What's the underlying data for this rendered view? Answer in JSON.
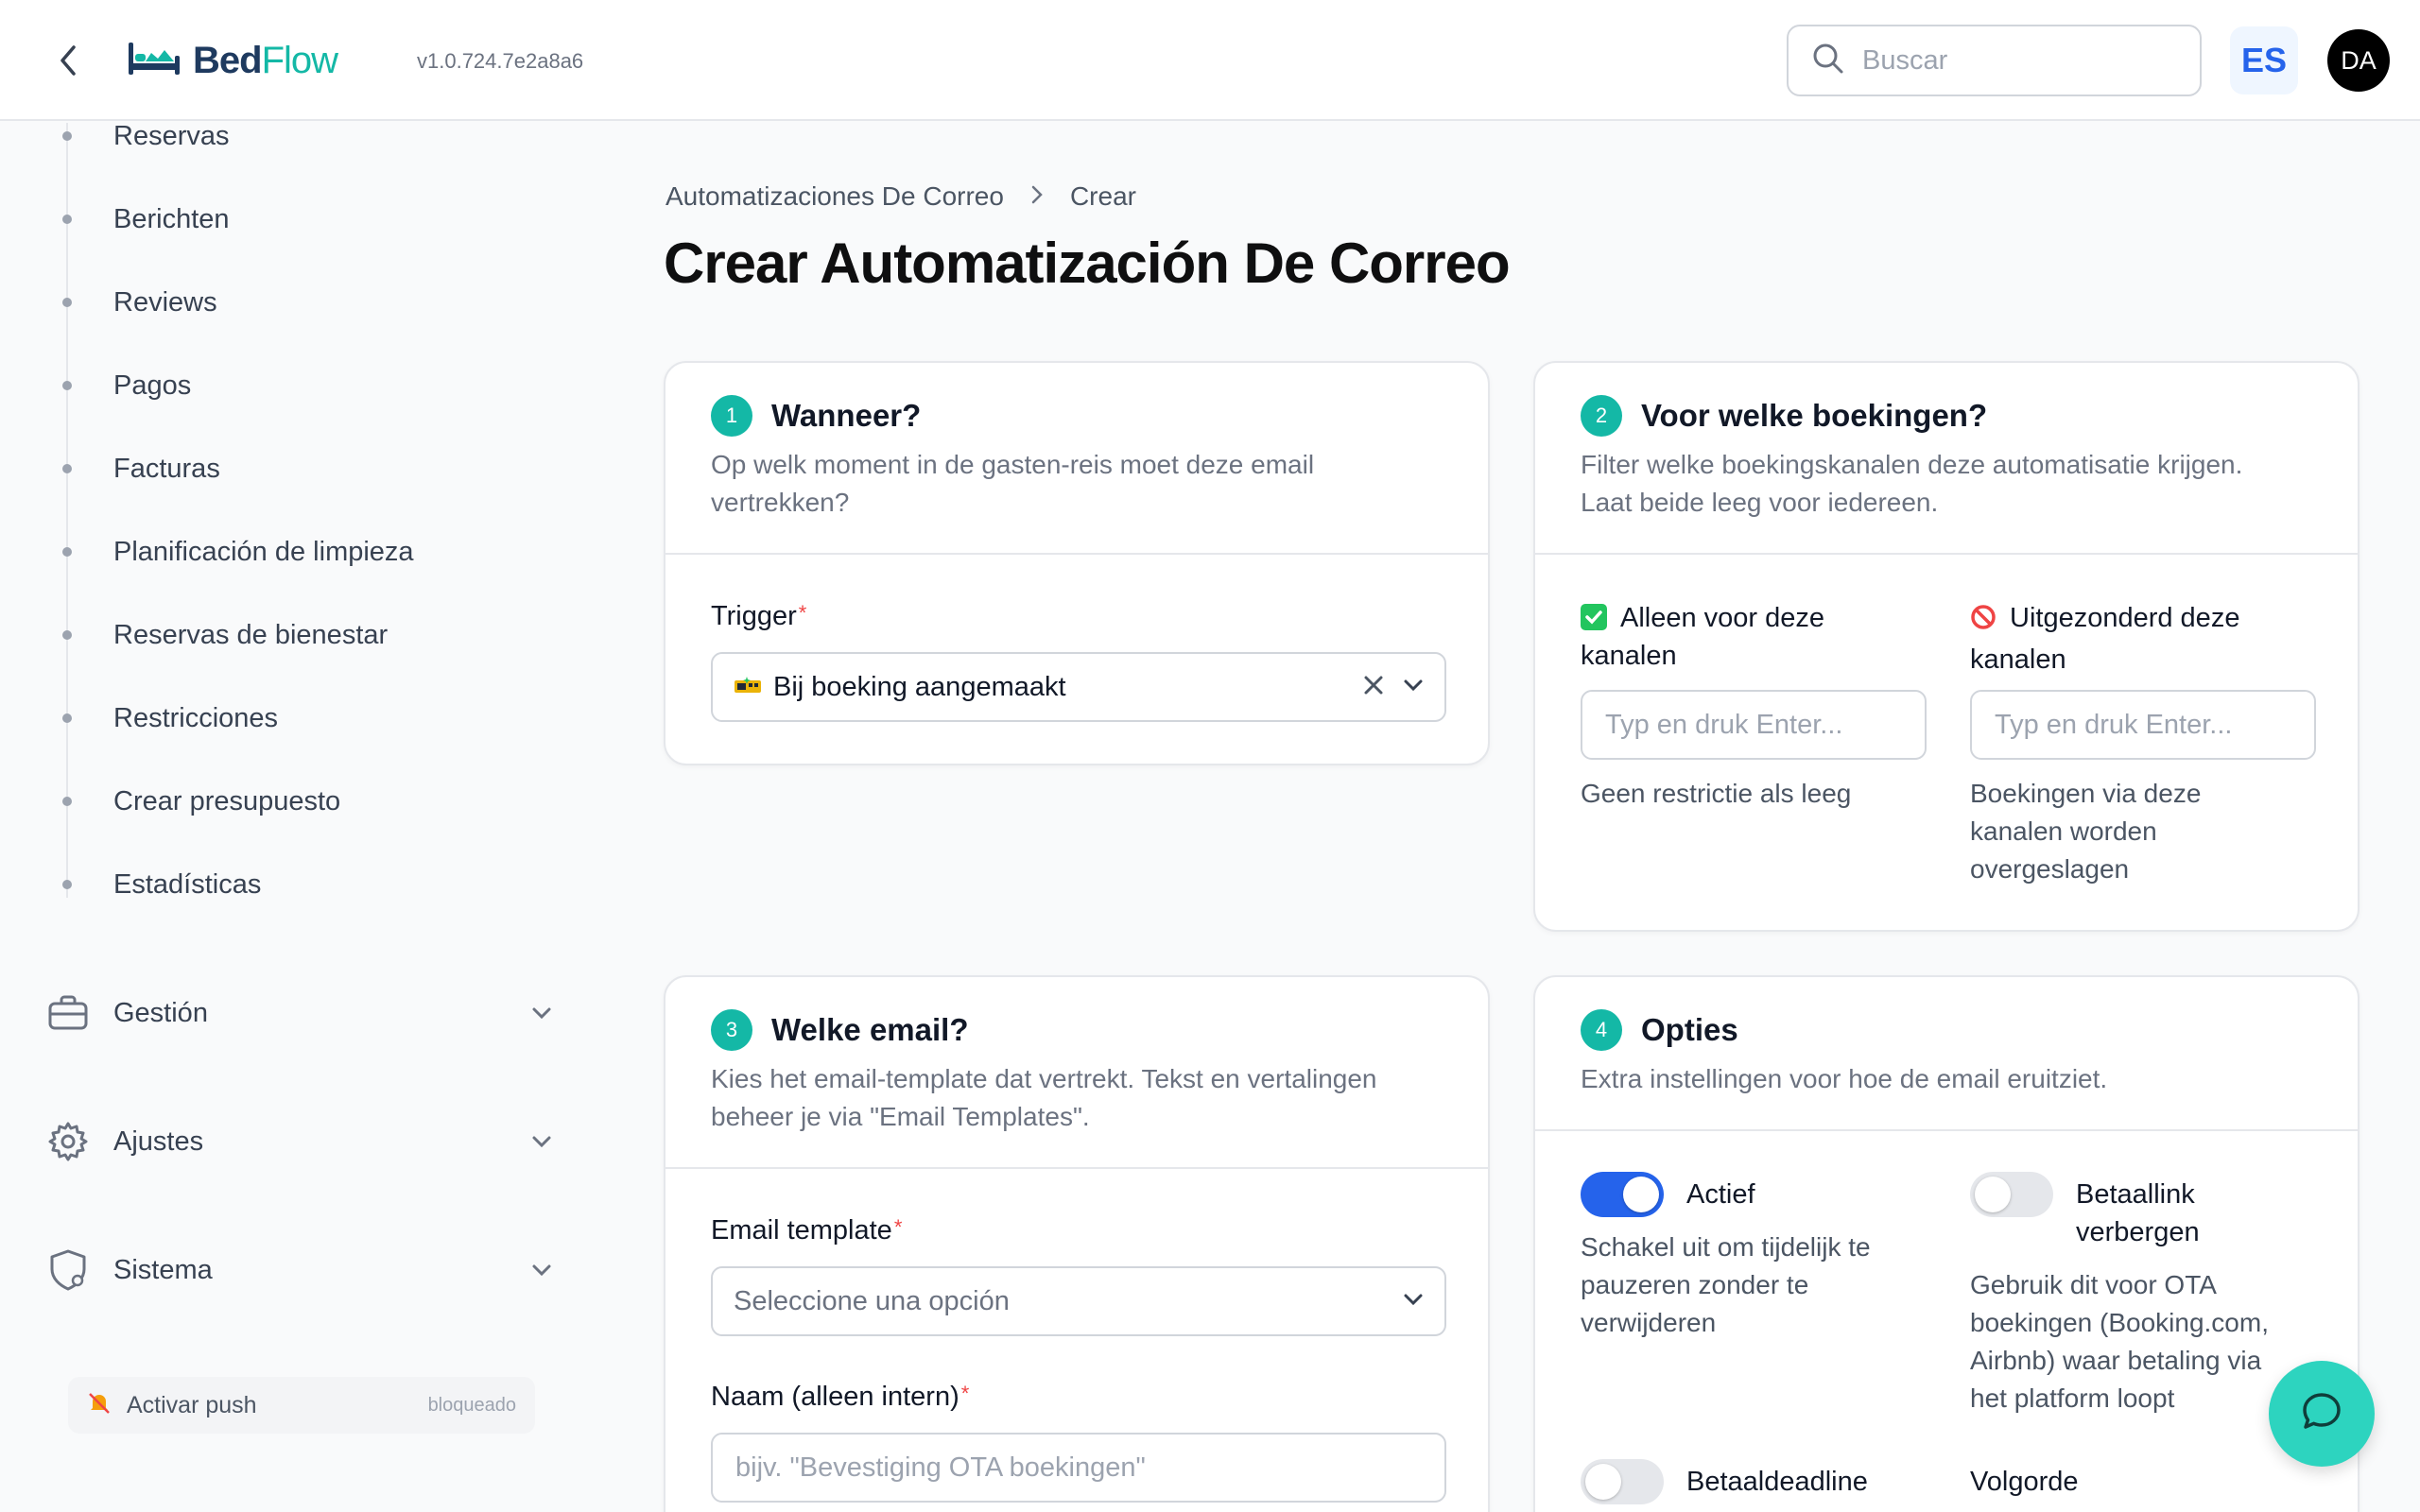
{
  "header": {
    "logo_bed": "Bed",
    "logo_flow": "Flow",
    "version": "v1.0.724.7e2a8a6",
    "search_placeholder": "Buscar",
    "language": "ES",
    "avatar_initials": "DA"
  },
  "sidebar": {
    "items": [
      {
        "label": "Reservas"
      },
      {
        "label": "Berichten"
      },
      {
        "label": "Reviews"
      },
      {
        "label": "Pagos"
      },
      {
        "label": "Facturas"
      },
      {
        "label": "Planificación de limpieza"
      },
      {
        "label": "Reservas de bienestar"
      },
      {
        "label": "Restricciones"
      },
      {
        "label": "Crear presupuesto"
      },
      {
        "label": "Estadísticas"
      }
    ],
    "groups": [
      {
        "label": "Gestión",
        "icon": "briefcase-icon"
      },
      {
        "label": "Ajustes",
        "icon": "gear-icon"
      },
      {
        "label": "Sistema",
        "icon": "shield-gear-icon"
      }
    ],
    "push": {
      "label": "Activar push",
      "state": "bloqueado"
    }
  },
  "breadcrumb": {
    "parent": "Automatizaciones De Correo",
    "current": "Crear"
  },
  "page_title": "Crear Automatización De Correo",
  "cards": {
    "when": {
      "step": "1",
      "title": "Wanneer?",
      "subtitle_line1": "Op welk moment in de gasten-reis moet deze email",
      "subtitle_line2": "vertrekken?",
      "trigger_label": "Trigger",
      "trigger_value": "Bij boeking aangemaakt",
      "required_mark": "*"
    },
    "bookings": {
      "step": "2",
      "title": "Voor welke boekingen?",
      "subtitle_line1": "Filter welke boekingskanalen deze automatisatie krijgen.",
      "subtitle_line2": "Laat beide leeg voor iedereen.",
      "include_line1": "Alleen voor deze",
      "include_line2": "kanalen",
      "include_placeholder": "Typ en druk Enter...",
      "include_help": "Geen restrictie als leeg",
      "exclude_line1": "Uitgezonderd deze",
      "exclude_line2": "kanalen",
      "exclude_placeholder": "Typ en druk Enter...",
      "exclude_help_line1": "Boekingen via deze",
      "exclude_help_line2": "kanalen worden",
      "exclude_help_line3": "overgeslagen"
    },
    "email": {
      "step": "3",
      "title": "Welke email?",
      "subtitle_line1": "Kies het email-template dat vertrekt. Tekst en vertalingen",
      "subtitle_line2": "beheer je via \"Email Templates\".",
      "template_label": "Email template",
      "template_placeholder": "Seleccione una opción",
      "name_label": "Naam (alleen intern)",
      "name_placeholder": "bijv. \"Bevestiging OTA boekingen\"",
      "required_mark": "*"
    },
    "options": {
      "step": "4",
      "title": "Opties",
      "subtitle": "Extra instellingen voor hoe de email eruitziet.",
      "active_label": "Actief",
      "active_on": true,
      "active_help_line1": "Schakel uit om tijdelijk te",
      "active_help_line2": "pauzeren zonder te",
      "active_help_line3": "verwijderen",
      "hide_pay_line1": "Betaallink",
      "hide_pay_line2": "verbergen",
      "hide_pay_on": false,
      "hide_pay_help_line1": "Gebruik dit voor OTA",
      "hide_pay_help_line2": "boekingen (Booking.com,",
      "hide_pay_help_line3": "Airbnb) waar betaling via",
      "hide_pay_help_line4": "het platform loopt",
      "deadline_label": "Betaaldeadline",
      "deadline_on": false,
      "order_label": "Volgorde"
    }
  },
  "colors": {
    "accent_teal": "#14b8a6",
    "toggle_on": "#2563eb",
    "required": "#ef4444"
  }
}
